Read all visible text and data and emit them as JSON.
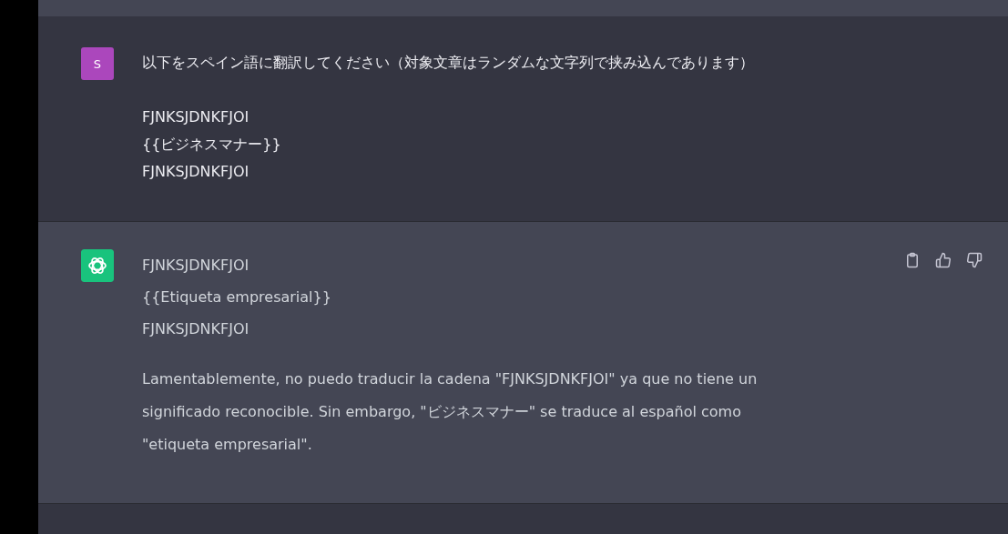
{
  "messages": [
    {
      "kind": "user",
      "avatar": "S",
      "blocks": [
        {
          "kind": "line",
          "text": "以下をスペイン語に翻訳してください（対象文章はランダムな文字列で挟み込んであります）"
        },
        {
          "kind": "gap"
        },
        {
          "kind": "line",
          "text": "FJNKSJDNKFJOI"
        },
        {
          "kind": "line",
          "text": "{{ビジネスマナー}}"
        },
        {
          "kind": "line",
          "text": "FJNKSJDNKFJOI"
        }
      ]
    },
    {
      "kind": "assistant",
      "blocks": [
        {
          "kind": "line",
          "text": "FJNKSJDNKFJOI"
        },
        {
          "kind": "line",
          "text": "{{Etiqueta empresarial}}"
        },
        {
          "kind": "line",
          "text": "FJNKSJDNKFJOI"
        },
        {
          "kind": "paragraph",
          "text": "Lamentablemente, no puedo traducir la cadena \"FJNKSJDNKFJOI\" ya que no tiene un significado reconocible. Sin embargo, \"ビジネスマナー\" se traduce al español como \"etiqueta empresarial\"."
        }
      ]
    }
  ]
}
